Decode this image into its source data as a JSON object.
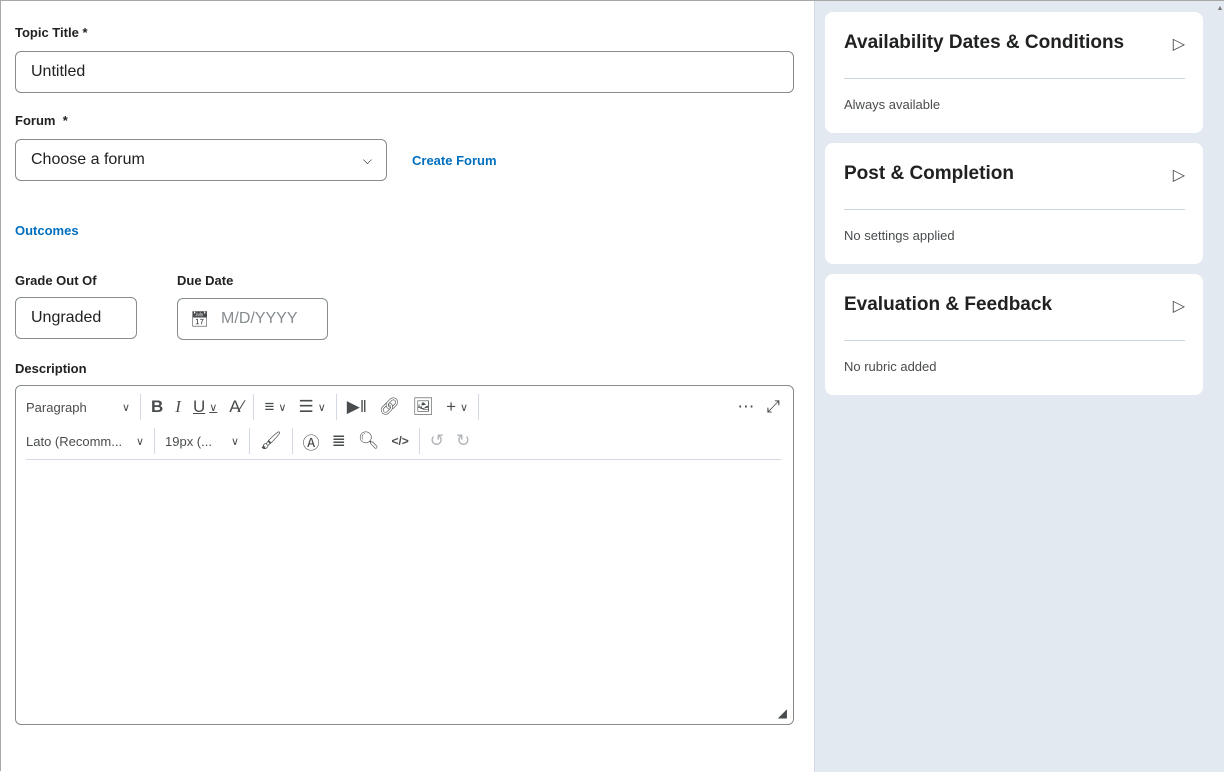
{
  "topic_title": {
    "label": "Topic Title",
    "required": "*",
    "value": "Untitled"
  },
  "forum": {
    "label": "Forum",
    "required": "*",
    "selected": "Choose a forum",
    "create_link": "Create Forum"
  },
  "outcomes_link": "Outcomes",
  "grade": {
    "label": "Grade Out Of",
    "value": "Ungraded"
  },
  "due_date": {
    "label": "Due Date",
    "placeholder": "M/D/YYYY"
  },
  "description": {
    "label": "Description"
  },
  "toolbar": {
    "format": "Paragraph",
    "font": "Lato (Recomm...",
    "size": "19px (..."
  },
  "cards": [
    {
      "title": "Availability Dates & Conditions",
      "summary": "Always available"
    },
    {
      "title": "Post & Completion",
      "summary": "No settings applied"
    },
    {
      "title": "Evaluation & Feedback",
      "summary": "No rubric added"
    }
  ]
}
